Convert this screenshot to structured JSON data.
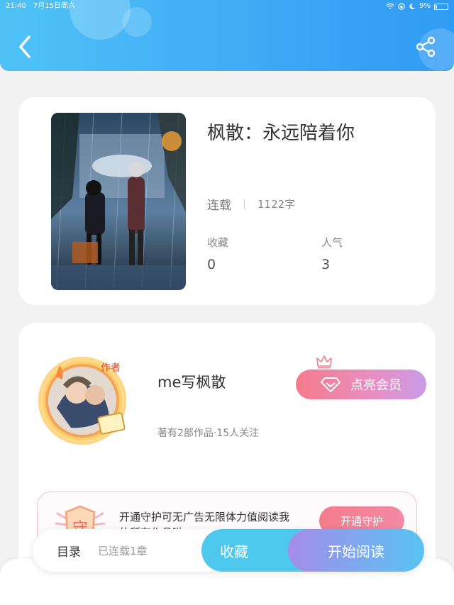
{
  "status_bar": {
    "time": "21:40",
    "date": "7月15日周六",
    "battery": "9%"
  },
  "header": {
    "back_icon": "back-arrow-icon",
    "share_icon": "share-icon"
  },
  "book": {
    "title": "枫散：永远陪着你",
    "status": "连载",
    "word_count": "1122字",
    "favorites_label": "收藏",
    "favorites_value": "0",
    "popularity_label": "人气",
    "popularity_value": "3"
  },
  "author": {
    "name": "me写枫散",
    "badge": "作者",
    "info": "著有2部作品·15人关注",
    "vip_button": "点亮会员"
  },
  "guard": {
    "icon_text": "守",
    "text": "开通守护可无广告无限体力值阅读我的所有作品呦",
    "button": "开通守护"
  },
  "bottom_bar": {
    "toc_label": "目录",
    "chapter_status": "已连载1章",
    "collect_label": "收藏",
    "read_label": "开始阅读"
  },
  "colors": {
    "header_start": "#4fc3f7",
    "header_end": "#2f9bf4",
    "vip_start": "#f57b8b",
    "vip_end": "#c99be6",
    "collect": "#4fc8ee"
  }
}
